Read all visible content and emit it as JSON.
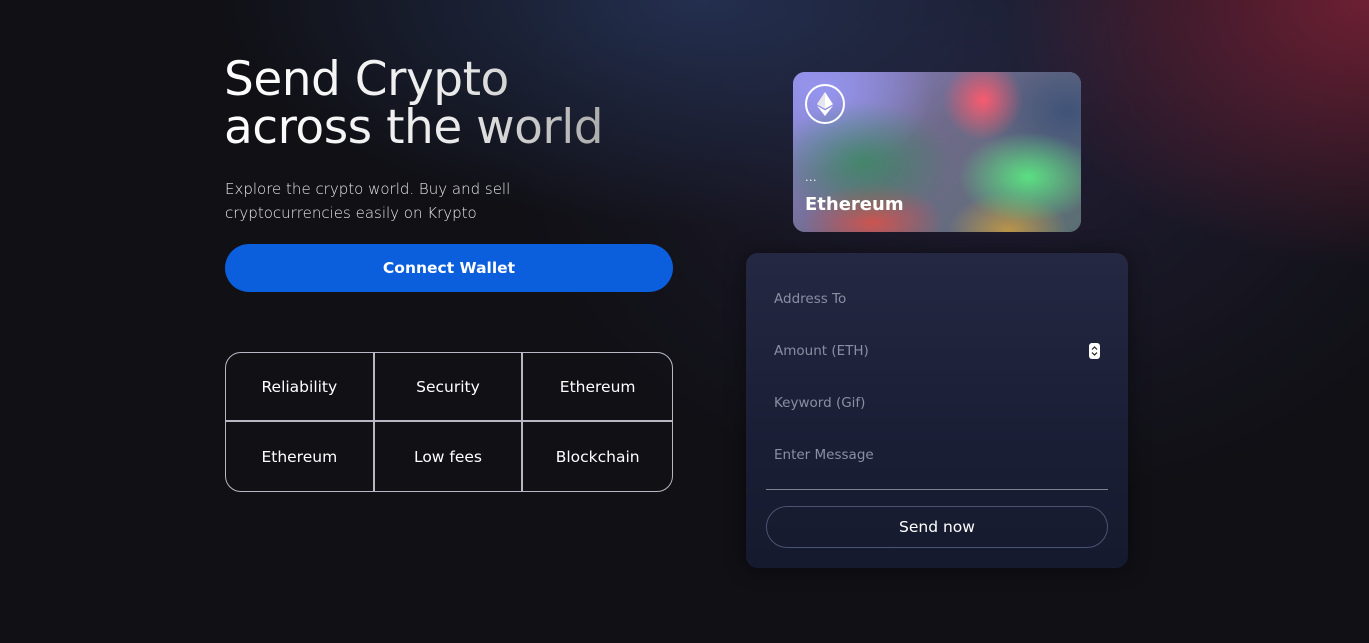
{
  "hero": {
    "title_line1": "Send Crypto",
    "title_line2": "across the world",
    "subtitle": "Explore the crypto world. Buy and sell cryptocurrencies easily on Krypto",
    "connect_label": "Connect Wallet"
  },
  "features": [
    "Reliability",
    "Security",
    "Ethereum",
    "Ethereum",
    "Low fees",
    "Blockchain"
  ],
  "card": {
    "icon": "ethereum-icon",
    "address": "...",
    "name": "Ethereum"
  },
  "form": {
    "address_placeholder": "Address To",
    "amount_placeholder": "Amount (ETH)",
    "keyword_placeholder": "Keyword (Gif)",
    "message_placeholder": "Enter Message",
    "send_label": "Send now"
  },
  "colors": {
    "background": "#101015",
    "primary_button": "#0b5fdc",
    "panel": "#1c2038"
  }
}
